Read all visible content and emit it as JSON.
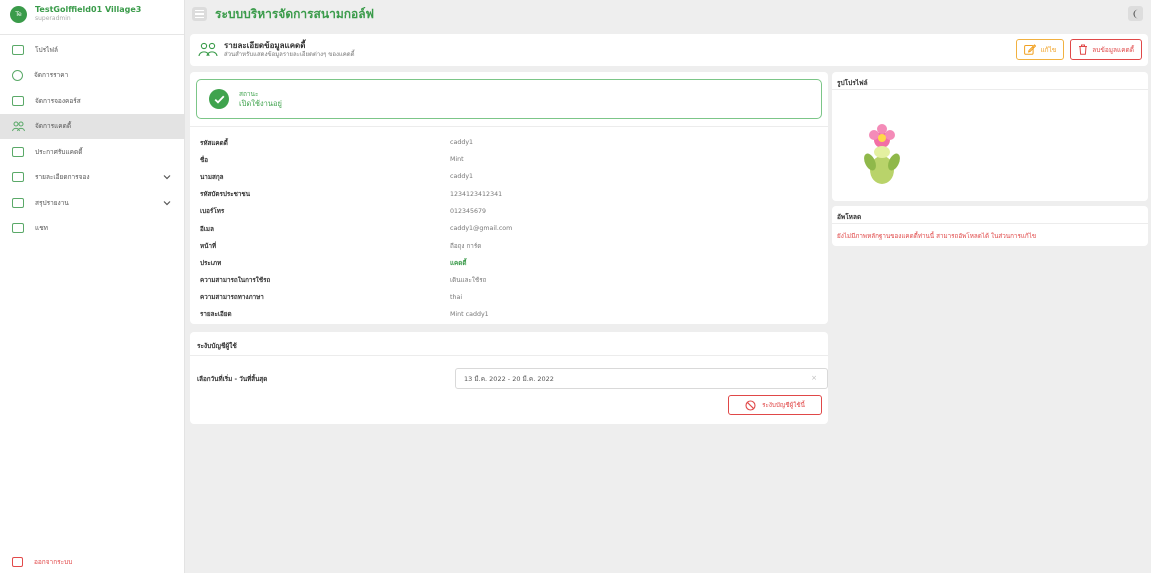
{
  "sidebar": {
    "avatar_initials": "Te",
    "title": "TestGolffield01 Village3",
    "role": "superadmin",
    "items": [
      {
        "label": "โปรไฟล์",
        "icon": "id-card-icon"
      },
      {
        "label": "จัดการราคา",
        "icon": "coin-icon"
      },
      {
        "label": "จัดการจองคอร์ส",
        "icon": "chart-icon"
      },
      {
        "label": "จัดการแคดดี้",
        "icon": "users-icon",
        "active": true
      },
      {
        "label": "ประกาศรับแคดดี้",
        "icon": "megaphone-icon"
      },
      {
        "label": "รายละเอียดการจอง",
        "icon": "list-icon",
        "expandable": true
      },
      {
        "label": "สรุปรายงาน",
        "icon": "report-icon",
        "expandable": true
      },
      {
        "label": "แชท",
        "icon": "chat-icon"
      }
    ],
    "logout_label": "ออกจากระบบ"
  },
  "topbar": {
    "title": "ระบบบริหารจัดการสนามกอล์ฟ"
  },
  "page_header": {
    "title": "รายละเอียดข้อมูลแคดดี้",
    "subtitle": "ส่วนสำหรับแสดงข้อมูลรายละเอียดต่างๆ ของแคดดี้",
    "edit_label": "แก้ไข",
    "delete_label": "ลบข้อมูลแคดดี้"
  },
  "status": {
    "title": "สถานะ",
    "value": "เปิดใช้งานอยู่"
  },
  "details": [
    {
      "label": "รหัสแคดดี้",
      "value": "caddy1"
    },
    {
      "label": "ชื่อ",
      "value": "Mint"
    },
    {
      "label": "นามสกุล",
      "value": "caddy1"
    },
    {
      "label": "รหัสบัตรประชาชน",
      "value": "1234123412341"
    },
    {
      "label": "เบอร์โทร",
      "value": "012345679"
    },
    {
      "label": "อีเมล",
      "value": "caddy1@gmail.com"
    },
    {
      "label": "หน้าที่",
      "value": "ถือถุง การ์ด"
    },
    {
      "label": "ประเภท",
      "value": "แคดดี้",
      "green": true
    },
    {
      "label": "ความสามารถในการใช้รถ",
      "value": "เดินและใช้รถ"
    },
    {
      "label": "ความสามารถทางภาษา",
      "value": "thai"
    },
    {
      "label": "รายละเอียด",
      "value": "Mint caddy1"
    }
  ],
  "profile": {
    "title": "รูปโปรไฟล์"
  },
  "attachments": {
    "title": "อัพโหลด",
    "message": "ยังไม่มีภาพหลักฐานของแคดดี้ท่านนี้ สามารถอัพโหลดได้ ในส่วนการแก้ไข"
  },
  "suspend": {
    "title": "ระงับบัญชีผู้ใช้",
    "date_label": "เลือกวันที่เริ่ม - วันที่สิ้นสุด",
    "date_value": "13 มี.ค. 2022 - 20 มี.ค. 2022",
    "clear_symbol": "×",
    "button_label": "ระงับบัญชีผู้ใช้นี้"
  },
  "colors": {
    "brand_green": "#3a9b4a",
    "danger_red": "#e04848",
    "warning_orange": "#f1a020"
  }
}
